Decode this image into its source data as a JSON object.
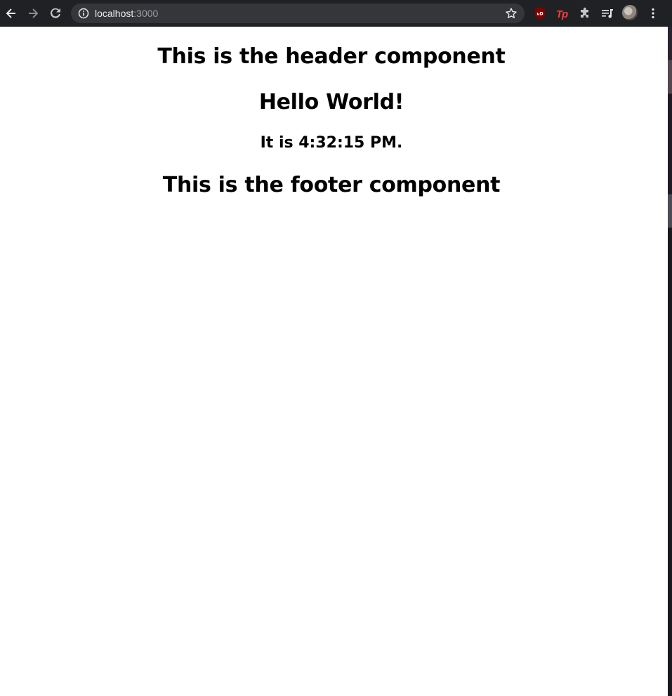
{
  "browser": {
    "url_host": "localhost",
    "url_port": ":3000",
    "icons": {
      "back": "arrow-left-icon",
      "forward": "arrow-right-icon",
      "reload": "reload-icon",
      "site_info": "info-icon",
      "bookmark": "star-icon",
      "ublock": "ublock-icon",
      "tp": "tp-extension-icon",
      "extensions": "puzzle-icon",
      "media": "media-control-icon",
      "profile": "avatar",
      "menu": "kebab-menu-icon"
    },
    "tp_label": "Tp",
    "ublock_label": "uD"
  },
  "page": {
    "header": "This is the header component",
    "greeting": "Hello World!",
    "time": "It is 4:32:15 PM.",
    "footer": "This is the footer component"
  },
  "colors": {
    "toolbar": "#202124",
    "omnibox": "#35363a",
    "ublock": "#800000",
    "tp": "#ff3b3b"
  }
}
